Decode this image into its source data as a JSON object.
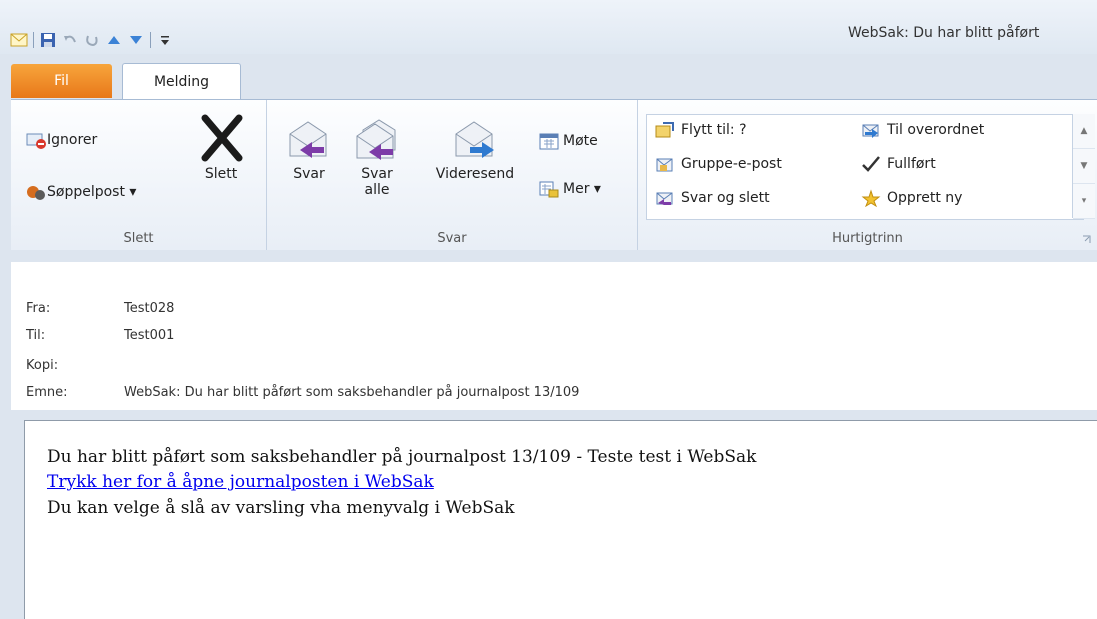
{
  "window": {
    "title": "WebSak: Du har blitt påført"
  },
  "tabs": {
    "file": "Fil",
    "message": "Melding"
  },
  "ribbon": {
    "groups": {
      "delete": "Slett",
      "reply": "Svar",
      "quicksteps": "Hurtigtrinn"
    },
    "ignore": "Ignorer",
    "junk": "Søppelpost ▾",
    "delete": "Slett",
    "reply": "Svar",
    "reply_all_1": "Svar",
    "reply_all_2": "alle",
    "forward": "Videresend",
    "meeting": "Møte",
    "more": "Mer ▾",
    "quicksteps": {
      "move_to": "Flytt til: ?",
      "team_email": "Gruppe-e-post",
      "reply_delete": "Svar og slett",
      "to_manager": "Til overordnet",
      "done": "Fullført",
      "create_new": "Opprett ny"
    }
  },
  "message": {
    "from_label": "Fra:",
    "from": "Test028",
    "to_label": "Til:",
    "to": "Test001",
    "cc_label": "Kopi:",
    "cc": "",
    "subject_label": "Emne:",
    "subject": "WebSak: Du har blitt påført som saksbehandler på journalpost 13/109",
    "body_line1": "Du har blitt påført som saksbehandler på journalpost 13/109 - Teste test i WebSak",
    "body_link": "Trykk her for å åpne journalposten i WebSak",
    "body_line3": "Du kan velge å slå av varsling vha menyvalg i WebSak"
  },
  "colors": {
    "file_tab": "#e87819",
    "link": "#0000ee",
    "accent": "#1e395b"
  }
}
